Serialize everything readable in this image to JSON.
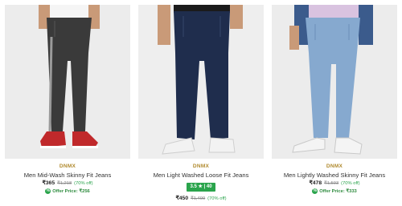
{
  "products": [
    {
      "brand": "DNMX",
      "title": "Men Mid-Wash Skinny Fit Jeans",
      "price": "₹365",
      "mrp": "₹1,218",
      "discount": "(70% off)",
      "offer": "Offer Price: ₹256",
      "image_icon": "jeans-photo-black",
      "colors": {
        "jeans": "#3a3a3a",
        "shoes": "#c0292b"
      }
    },
    {
      "brand": "DNMX",
      "title": "Men Light Washed Loose Fit Jeans",
      "rating": "3.5 ★ | 40",
      "price": "₹450",
      "mrp": "₹1,499",
      "discount": "(70% off)",
      "image_icon": "jeans-photo-navy",
      "colors": {
        "jeans": "#1f2d4d",
        "shoes": "#f2f2f2"
      }
    },
    {
      "brand": "DNMX",
      "title": "Men Lightly Washed Skinny Fit Jeans",
      "price": "₹478",
      "mrp": "₹1,593",
      "discount": "(70% off)",
      "offer": "Offer Price: ₹333",
      "image_icon": "jeans-photo-lightblue",
      "colors": {
        "jeans": "#86a9cf",
        "shoes": "#f4f4f4"
      }
    }
  ],
  "colors": {
    "accent_green": "#2aa44c",
    "brand_gold": "#b08a2e"
  }
}
